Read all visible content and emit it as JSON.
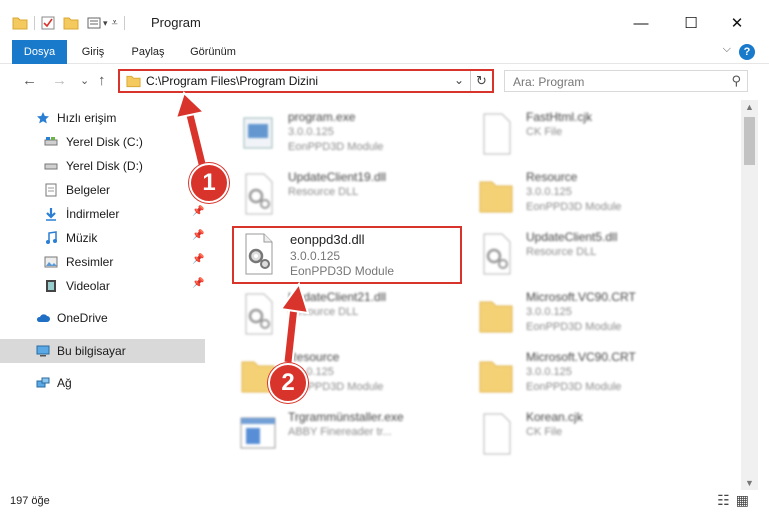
{
  "window": {
    "title": "Program",
    "minimize_glyph": "—",
    "maximize_glyph": "☐",
    "close_glyph": "✕"
  },
  "ribbon": {
    "tabs": [
      "Dosya",
      "Giriş",
      "Paylaş",
      "Görünüm"
    ],
    "help_glyph": "?"
  },
  "navigation": {
    "back_glyph": "←",
    "forward_glyph": "→",
    "recent_glyph": "⌄",
    "up_glyph": "↑",
    "address_path": "C:\\Program Files\\Program Dizini",
    "search_placeholder": "Ara: Program"
  },
  "sidebar": {
    "items": [
      {
        "label": "Hızlı erişim",
        "icon": "star-icon",
        "pinned": false
      },
      {
        "label": "Yerel Disk (C:)",
        "icon": "drive-icon",
        "pinned": false
      },
      {
        "label": "Yerel Disk (D:)",
        "icon": "drive-icon",
        "pinned": false
      },
      {
        "label": "Belgeler",
        "icon": "document-icon",
        "pinned": false
      },
      {
        "label": "İndirmeler",
        "icon": "download-icon",
        "pinned": true
      },
      {
        "label": "Müzik",
        "icon": "music-icon",
        "pinned": true
      },
      {
        "label": "Resimler",
        "icon": "picture-icon",
        "pinned": true
      },
      {
        "label": "Videolar",
        "icon": "video-icon",
        "pinned": true
      },
      {
        "label": "OneDrive",
        "icon": "cloud-icon",
        "pinned": false
      },
      {
        "label": "Bu bilgisayar",
        "icon": "computer-icon",
        "pinned": false,
        "selected": true
      },
      {
        "label": "Ağ",
        "icon": "network-icon",
        "pinned": false
      }
    ]
  },
  "files": [
    {
      "name": "program.exe",
      "line2": "3.0.0.125",
      "line3": "EonPPD3D Module",
      "icon": "exe-icon",
      "blurred": true
    },
    {
      "name": "FastHtml.cjk",
      "line2": "CK File",
      "line3": "",
      "icon": "file-icon",
      "blurred": true
    },
    {
      "name": "UpdateClient19.dll",
      "line2": "Resource DLL",
      "line3": "",
      "icon": "dll-icon",
      "blurred": true
    },
    {
      "name": "Resource",
      "line2": "3.0.0.125",
      "line3": "EonPPD3D Module",
      "icon": "folder-icon",
      "blurred": true
    },
    {
      "name": "eonppd3d.dll",
      "line2": "3.0.0.125",
      "line3": "EonPPD3D Module",
      "icon": "dll-icon",
      "blurred": false,
      "highlighted": true
    },
    {
      "name": "UpdateClient5.dll",
      "line2": "Resource DLL",
      "line3": "",
      "icon": "dll-icon",
      "blurred": true
    },
    {
      "name": "UpdateClient21.dll",
      "line2": "Resource DLL",
      "line3": "",
      "icon": "dll-icon",
      "blurred": true
    },
    {
      "name": "Microsoft.VC90.CRT",
      "line2": "3.0.0.125",
      "line3": "EonPPD3D Module",
      "icon": "folder-icon",
      "blurred": true
    },
    {
      "name": "Resource",
      "line2": "3.0.0.125",
      "line3": "EonPPD3D Module",
      "icon": "folder-icon",
      "blurred": true
    },
    {
      "name": "Microsoft.VC90.CRT",
      "line2": "3.0.0.125",
      "line3": "EonPPD3D Module",
      "icon": "folder-icon",
      "blurred": true
    },
    {
      "name": "Trgrammünstaller.exe",
      "line2": "ABBY Finereader tr...",
      "line3": "",
      "icon": "installer-icon",
      "blurred": true
    },
    {
      "name": "Korean.cjk",
      "line2": "CK File",
      "line3": "",
      "icon": "file-icon",
      "blurred": true
    }
  ],
  "status": {
    "item_count": "197 öğe"
  },
  "annotations": {
    "step1": "1",
    "step2": "2"
  },
  "colors": {
    "accent": "#1979ca",
    "highlight": "#d9342b",
    "selected_bg": "#d9d9d9"
  }
}
